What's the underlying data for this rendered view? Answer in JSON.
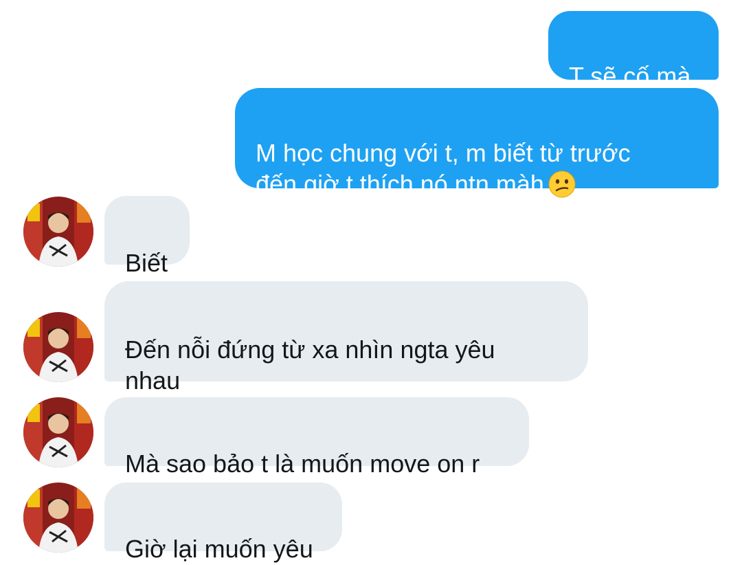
{
  "colors": {
    "sent_bubble": "#1ea1f2",
    "received_bubble": "#e6ecf0",
    "sent_text": "#ffffff",
    "received_text": "#14171a"
  },
  "messages": [
    {
      "direction": "sent",
      "text": "T sẽ cố mà"
    },
    {
      "direction": "sent",
      "text": "M học chung với t, m biết từ trước\nđến giờ t thích nó ntn màh",
      "emoji": "confused-face-emoji"
    },
    {
      "direction": "received",
      "text": "Biết",
      "avatar": "contact-avatar"
    },
    {
      "direction": "received",
      "text": "Đến nỗi đứng từ xa nhìn ngta yêu\nnhau",
      "avatar": "contact-avatar"
    },
    {
      "direction": "received",
      "text": "Mà sao bảo t là muốn move on r",
      "avatar": "contact-avatar"
    },
    {
      "direction": "received",
      "text": "Giờ lại muốn yêu",
      "avatar": "contact-avatar"
    }
  ]
}
